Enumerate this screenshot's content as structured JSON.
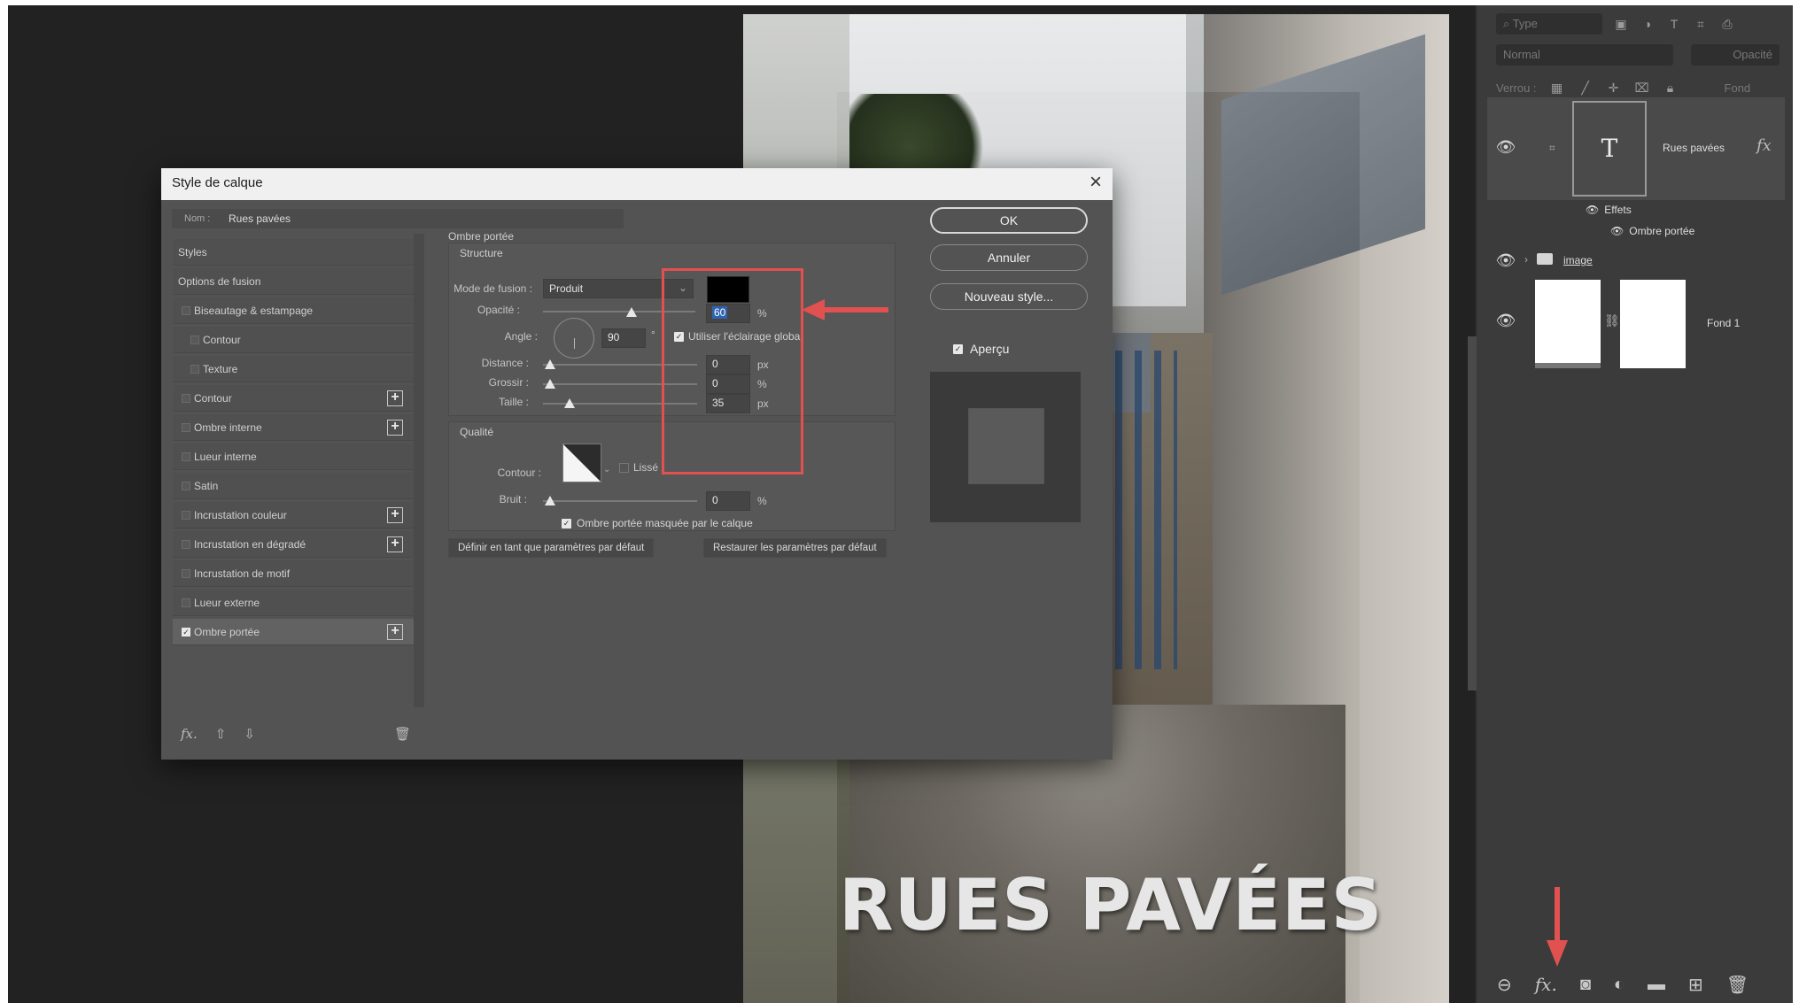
{
  "canvas": {
    "title": "RUES PAVÉES"
  },
  "dialog": {
    "title": "Style de calque",
    "name_label": "Nom :",
    "name_value": "Rues pavées",
    "styles": [
      {
        "label": "Styles",
        "kind": "header"
      },
      {
        "label": "Options de fusion",
        "kind": "header"
      },
      {
        "label": "Biseautage & estampage",
        "kind": "item"
      },
      {
        "label": "Contour",
        "kind": "sub"
      },
      {
        "label": "Texture",
        "kind": "sub"
      },
      {
        "label": "Contour",
        "kind": "item",
        "plus": true
      },
      {
        "label": "Ombre interne",
        "kind": "item",
        "plus": true
      },
      {
        "label": "Lueur interne",
        "kind": "item"
      },
      {
        "label": "Satin",
        "kind": "item"
      },
      {
        "label": "Incrustation couleur",
        "kind": "item",
        "plus": true
      },
      {
        "label": "Incrustation en dégradé",
        "kind": "item",
        "plus": true
      },
      {
        "label": "Incrustation de motif",
        "kind": "item"
      },
      {
        "label": "Lueur externe",
        "kind": "item"
      },
      {
        "label": "Ombre portée",
        "kind": "item",
        "plus": true,
        "checked": true,
        "selected": true
      }
    ],
    "section_title": "Ombre portée",
    "structure": {
      "title": "Structure",
      "blend_label": "Mode de fusion :",
      "blend_value": "Produit",
      "shadow_color": "#000000",
      "opacity_label": "Opacité :",
      "opacity_value": "60",
      "opacity_unit": "%",
      "angle_label": "Angle :",
      "angle_value": "90",
      "angle_unit": "°",
      "global_light": "Utiliser l'éclairage global",
      "distance_label": "Distance :",
      "distance_value": "0",
      "distance_unit": "px",
      "spread_label": "Grossir :",
      "spread_value": "0",
      "spread_unit": "%",
      "size_label": "Taille :",
      "size_value": "35",
      "size_unit": "px"
    },
    "quality": {
      "title": "Qualité",
      "contour_label": "Contour :",
      "smooth_label": "Lissé",
      "noise_label": "Bruit :",
      "noise_value": "0",
      "noise_unit": "%"
    },
    "masked_label": "Ombre portée masquée par le calque",
    "default_button": "Définir en tant que paramètres par défaut",
    "restore_button": "Restaurer les paramètres par défaut",
    "ok_button": "OK",
    "cancel_button": "Annuler",
    "new_style_button": "Nouveau style...",
    "preview_label": "Aperçu"
  },
  "layers": {
    "search_placeholder": "Type",
    "blend_mode": "Normal",
    "opacity_label": "Opacité",
    "lock_label": "Verrou :",
    "fill_label": "Fond",
    "text_layer_name": "Rues pavées",
    "effects_label": "Effets",
    "drop_shadow_label": "Ombre portée",
    "group_name": "image",
    "fond_name": "Fond 1"
  },
  "accent": {
    "annotation": "#e0514f",
    "highlight": "#2f63b1"
  }
}
